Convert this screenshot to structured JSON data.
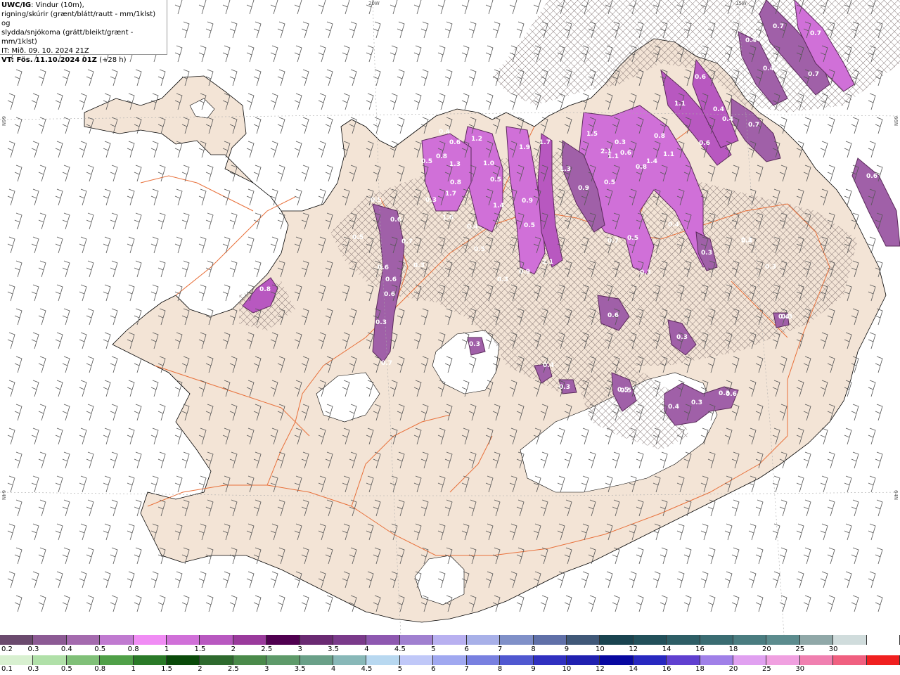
{
  "title_box": {
    "product": "UWC/IG",
    "line1": ": Vindur (10m),",
    "line2": "rigning/skúrir (grænt/blátt/rautt - mm/1klst) og",
    "line3": "slydda/snjókoma (grátt/bleikt/grænt - mm/1klst)",
    "it": "IT: Mið. 09. 10. 2024 21Z",
    "vt": "VT: Fös. 11.10.2024 01Z",
    "lead": "(+28 h)"
  },
  "grid_labels": {
    "top_20w": "20W",
    "top_15w": "15W",
    "left_66n": "66N",
    "right_66n": "66N",
    "left_64n": "64N",
    "right_64n": "64N"
  },
  "colors": {
    "sea": "#ffffff",
    "land": "#f3e4d6",
    "roads": "#e8703a",
    "coast": "#000000",
    "glacier": "#ffffff",
    "precip_light": "#a060a8",
    "precip_mid": "#d070d8",
    "precip_heavy": "#f090f0",
    "precip_dark": "#7a3a78",
    "hatch": "#6a5a5a"
  },
  "precip_labels": [
    "0.7",
    "0.7",
    "0.4",
    "0.4",
    "0.7",
    "1.1",
    "0.4",
    "0.6",
    "0.4",
    "0.6",
    "0.6",
    "0.7",
    "0.6",
    "0.5",
    "1.2",
    "0.4",
    "0.8",
    "1.3",
    "1.0",
    "0.5",
    "1.9",
    "1.7",
    "1.5",
    "0.3",
    "2.1",
    "0.6",
    "0.8",
    "0.8",
    "1.4",
    "1.1",
    "1.1",
    "1.7",
    "0.8",
    "0.5",
    "1.3",
    "0.9",
    "1.4",
    "0.9",
    "0.9",
    "1.6",
    "0.4",
    "0.5",
    "0.6",
    "0.3",
    "0.5",
    "2.1",
    "0.5",
    "0.3",
    "0.7",
    "0.5",
    "0.3",
    "0.7",
    "0.6",
    "0.6",
    "0.3",
    "0.8",
    "0.6",
    "0.6",
    "0.3",
    "0.4",
    "0.3",
    "0.5",
    "0.3",
    "0.3",
    "0.7",
    "0.3",
    "0.3",
    "0.3",
    "0.4",
    "0.3",
    "0.6",
    "0.5",
    "0.4",
    "0.3",
    "0.4",
    "0.3",
    "0.4",
    "0.5"
  ],
  "legend": {
    "snow_colors": [
      "#6b4a6e",
      "#8c5a94",
      "#a46aae",
      "#c07ad0",
      "#f08cf4",
      "#d070d8",
      "#b858c0",
      "#9a3a9c",
      "#500050",
      "#6a2a72",
      "#7a3a8a",
      "#8e58b0",
      "#a080d0",
      "#b8b0f0",
      "#a8b0e8",
      "#8090c8",
      "#6070a8",
      "#405878",
      "#1a4450",
      "#22505a",
      "#2e5e66",
      "#3a6c72",
      "#4a7c80",
      "#5c8c8e",
      "#90a8a8",
      "#d0dcdc",
      "#ffffff"
    ],
    "snow_labels": [
      "0.2",
      "0.3",
      "0.4",
      "0.5",
      "0.8",
      "1",
      "1.5",
      "2",
      "2.5",
      "3",
      "3.5",
      "4",
      "4.5",
      "5",
      "6",
      "7",
      "8",
      "9",
      "10",
      "12",
      "14",
      "16",
      "18",
      "20",
      "25",
      "30"
    ],
    "rain_colors": [
      "#d8f0d0",
      "#b0e0a8",
      "#80c078",
      "#50a048",
      "#2a7a28",
      "#0a4a0a",
      "#2e6a2e",
      "#4a8a4a",
      "#5e9a6a",
      "#6aa088",
      "#88b8b8",
      "#b8d8f0",
      "#c0c8f8",
      "#a0a8f0",
      "#7880e0",
      "#5058d0",
      "#3030c0",
      "#2020b0",
      "#0808a0",
      "#2828c0",
      "#6040d0",
      "#a080e8",
      "#e0a0f0",
      "#f0a0e0",
      "#f080b0",
      "#f06080",
      "#f02020"
    ],
    "rain_labels": [
      "0.1",
      "0.3",
      "0.5",
      "0.8",
      "1",
      "1.5",
      "2",
      "2.5",
      "3",
      "3.5",
      "4",
      "4.5",
      "5",
      "6",
      "7",
      "8",
      "9",
      "10",
      "12",
      "14",
      "16",
      "18",
      "20",
      "25",
      "30"
    ]
  }
}
